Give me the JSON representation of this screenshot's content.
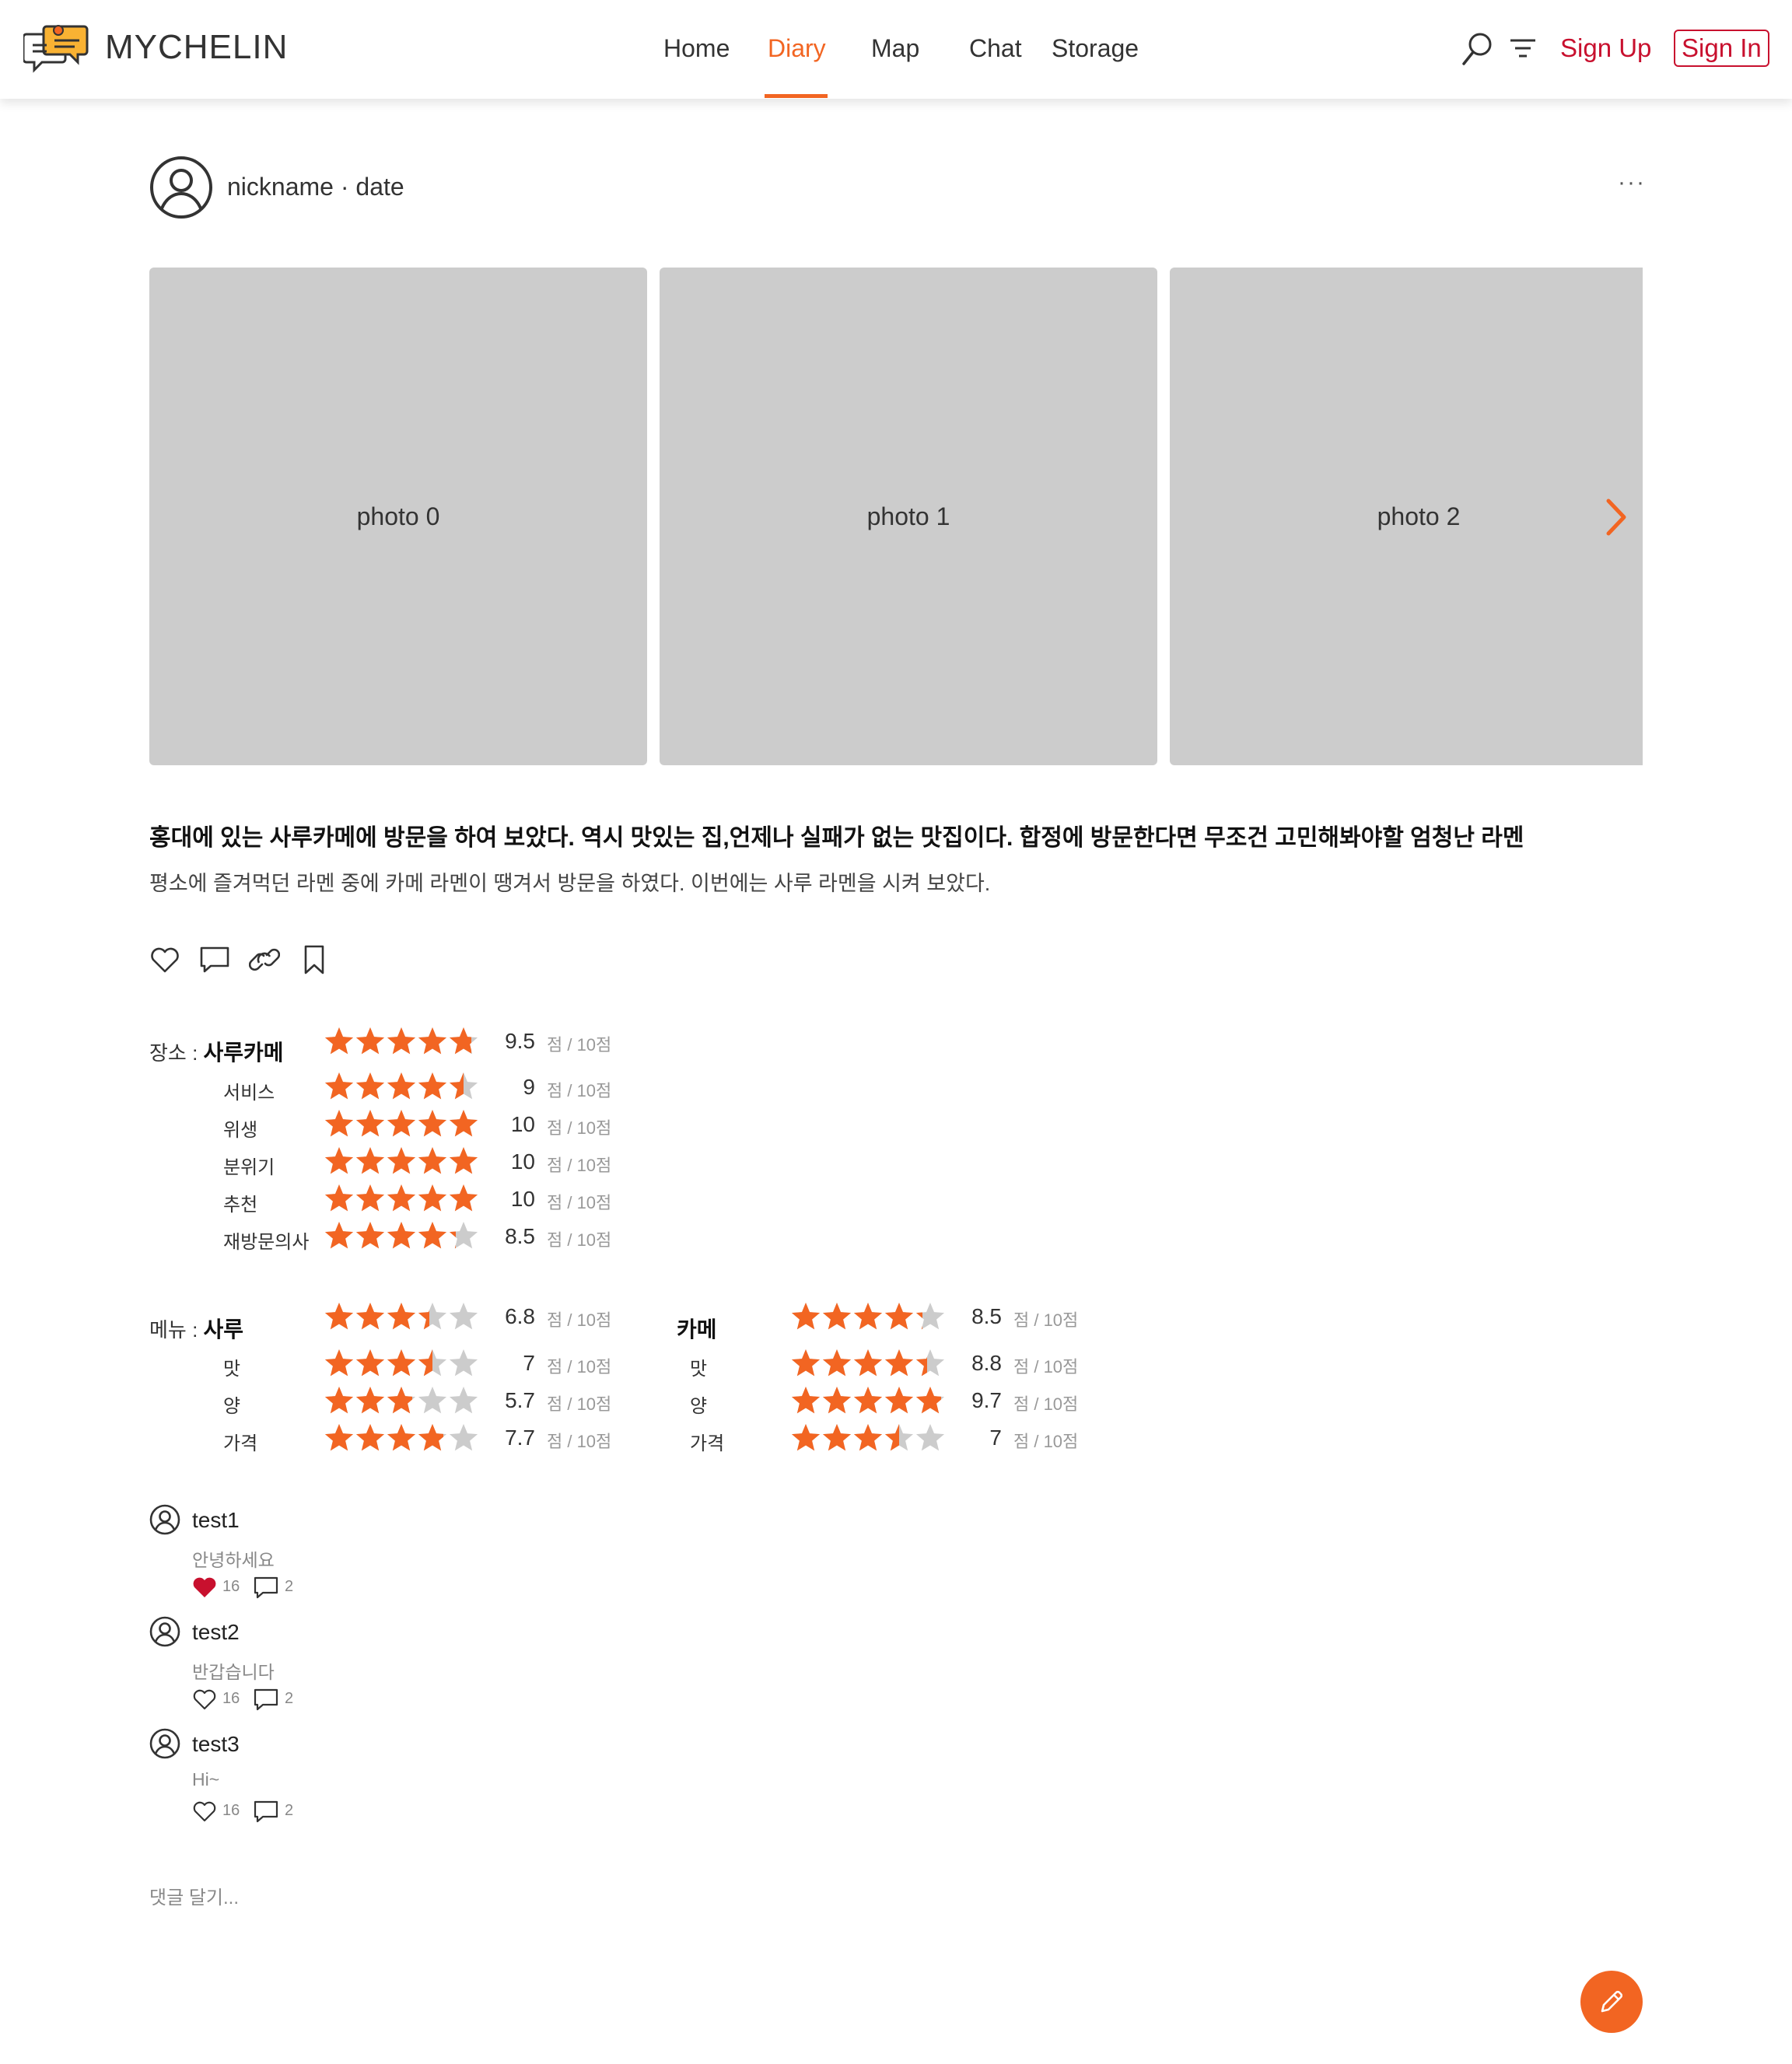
{
  "header": {
    "brand": "MYCHELIN",
    "nav": [
      {
        "label": "Home"
      },
      {
        "label": "Diary",
        "active": true
      },
      {
        "label": "Map"
      },
      {
        "label": "Chat"
      },
      {
        "label": "Storage"
      }
    ],
    "sign_up": "Sign Up",
    "sign_in": "Sign In",
    "icons": [
      "search-icon",
      "filter-icon"
    ]
  },
  "post": {
    "nickname": "nickname",
    "separator": "·",
    "date": "date",
    "more": "···",
    "photos": [
      "photo 0",
      "photo 1",
      "photo 2"
    ],
    "title": "홍대에 있는 사루카메에 방문을 하여 보았다. 역시 맛있는 집,언제나 실패가 없는 맛집이다. 합정에 방문한다면 무조건 고민해봐야할 엄청난 라멘",
    "description": "평소에 즐겨먹던 라멘 중에 카메 라멘이 땡겨서 방문을 하였다. 이번에는 사루 라멘을 시켜 보았다.",
    "actions": [
      "heart-icon",
      "comment-icon",
      "link-icon",
      "bookmark-icon"
    ]
  },
  "ratings": {
    "max_label": "점 / 10점",
    "place": {
      "prefix": "장소 :",
      "name": "사루카메",
      "score": 9.5,
      "items": [
        {
          "label": "서비스",
          "score": 9
        },
        {
          "label": "위생",
          "score": 10
        },
        {
          "label": "분위기",
          "score": 10
        },
        {
          "label": "추천",
          "score": 10
        },
        {
          "label": "재방문의사",
          "score": 8.5
        }
      ]
    },
    "menu_prefix": "메뉴 :",
    "menus": [
      {
        "name": "사루",
        "score": 6.8,
        "items": [
          {
            "label": "맛",
            "score": 7
          },
          {
            "label": "양",
            "score": 5.7
          },
          {
            "label": "가격",
            "score": 7.7
          }
        ]
      },
      {
        "name": "카메",
        "score": 8.5,
        "items": [
          {
            "label": "맛",
            "score": 8.8
          },
          {
            "label": "양",
            "score": 9.7
          },
          {
            "label": "가격",
            "score": 7
          }
        ]
      }
    ]
  },
  "comments": [
    {
      "user": "test1",
      "text": "안녕하세요",
      "likes": 16,
      "replies": 2,
      "liked": true
    },
    {
      "user": "test2",
      "text": "반갑습니다",
      "likes": 16,
      "replies": 2,
      "liked": false
    },
    {
      "user": "test3",
      "text": "Hi~",
      "likes": 16,
      "replies": 2,
      "liked": false
    }
  ],
  "comment_placeholder": "댓글 달기...",
  "colors": {
    "accent": "#f26522",
    "brand_red": "#c8102e",
    "star_empty": "#cccccc",
    "photo_bg": "#cccccc"
  }
}
